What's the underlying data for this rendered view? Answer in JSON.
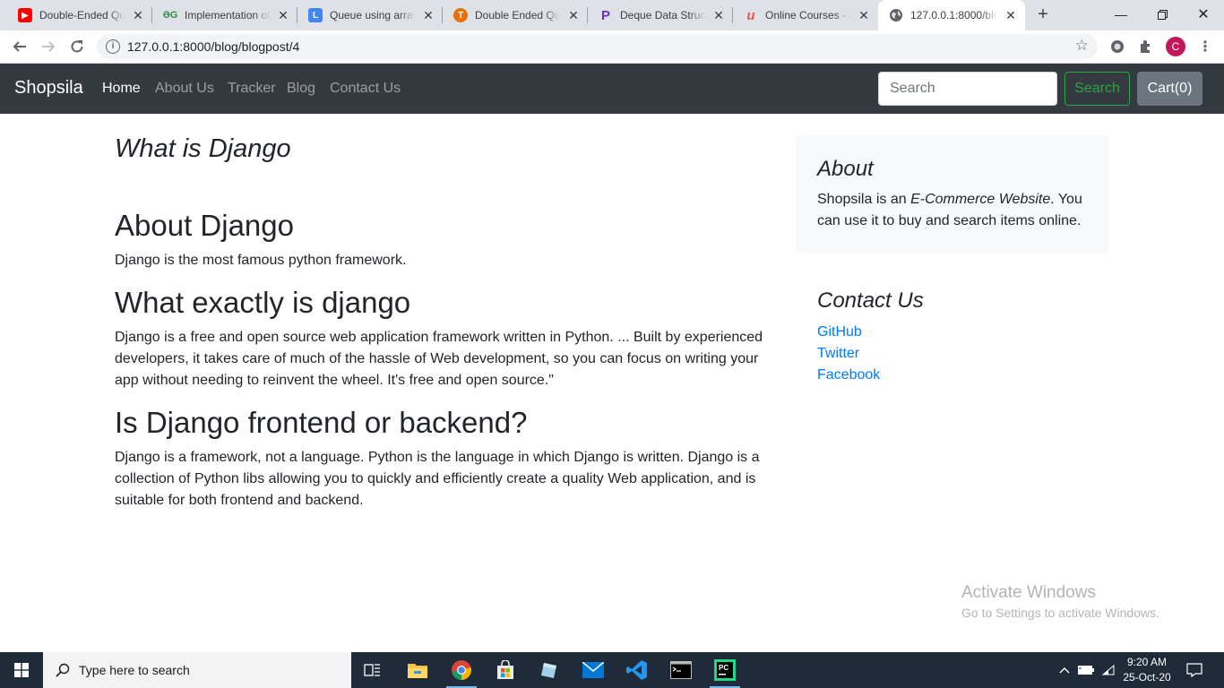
{
  "browser": {
    "tabs": [
      {
        "title": "Double-Ended Qu",
        "icon": "youtube-icon",
        "color": "#ff0000"
      },
      {
        "title": "Implementation of",
        "icon": "geeksforgeeks-icon",
        "color": "#2f8d46"
      },
      {
        "title": "Queue using array",
        "icon": "l-icon",
        "color": "#4285f4"
      },
      {
        "title": "Double Ended Qu",
        "icon": "tutorial-icon",
        "color": "#e8710a"
      },
      {
        "title": "Deque Data Struct",
        "icon": "programiz-icon",
        "color": "#6f2dbd"
      },
      {
        "title": "Online Courses - A",
        "icon": "udemy-icon",
        "color": "#ec5252"
      },
      {
        "title": "127.0.0.1:8000/blo",
        "icon": "globe-icon",
        "color": "#5f6368"
      }
    ],
    "url": "127.0.0.1:8000/blog/blogpost/4",
    "profile_initial": "C"
  },
  "navbar": {
    "brand": "Shopsila",
    "links": [
      "Home",
      "About Us",
      "Tracker",
      "Blog",
      "Contact Us"
    ],
    "search_placeholder": "Search",
    "search_button": "Search",
    "cart_button": "Cart(0)"
  },
  "post": {
    "title": "What is Django",
    "sections": [
      {
        "heading": "About Django",
        "text": "Django is the most famous python framework."
      },
      {
        "heading": "What exactly is django",
        "text": "Django is a free and open source web application framework written in Python. ... Built by experienced developers, it takes care of much of the hassle of Web development, so you can focus on writing your app without needing to reinvent the wheel. It's free and open source.\""
      },
      {
        "heading": "Is Django frontend or backend?",
        "text": "Django is a framework, not a language. Python is the language in which Django is written. Django is a collection of Python libs allowing you to quickly and efficiently create a quality Web application, and is suitable for both frontend and backend."
      }
    ]
  },
  "sidebar": {
    "about_heading": "About",
    "about_prefix": "Shopsila is an ",
    "about_emphasis": "E-Commerce Website",
    "about_suffix": ". You can use it to buy and search items online.",
    "contact_heading": "Contact Us",
    "contact_links": [
      "GitHub",
      "Twitter",
      "Facebook"
    ]
  },
  "watermark": {
    "line1": "Activate Windows",
    "line2": "Go to Settings to activate Windows."
  },
  "taskbar": {
    "search_placeholder": "Type here to search",
    "time": "9:20 AM",
    "date": "25-Oct-20"
  }
}
